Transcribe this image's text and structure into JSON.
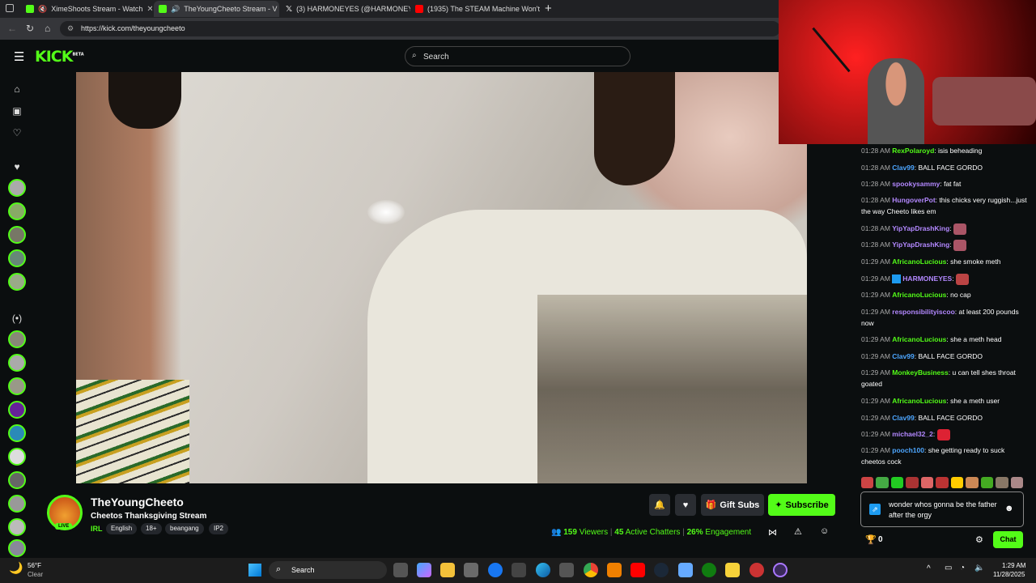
{
  "browser": {
    "tabs": [
      {
        "label": "XimeShoots Stream - Watch",
        "icon": "kick-icon",
        "color": "#53fc18"
      },
      {
        "label": "TheYoungCheeto Stream - V",
        "icon": "kick-icon",
        "color": "#53fc18"
      },
      {
        "label": "(3) HARMONEYES (@HARMONEY",
        "icon": "x-icon",
        "color": "#ffffff"
      },
      {
        "label": "(1935) The STEAM Machine Won't",
        "icon": "youtube-icon",
        "color": "#ff0000"
      }
    ],
    "url": "https://kick.com/theyoungcheeto"
  },
  "header": {
    "logo": "KICK",
    "logo_sup": "BETA",
    "search_placeholder": "Search"
  },
  "channel": {
    "name": "TheYoungCheeto",
    "title": "Cheetos Thanksgiving Stream",
    "live": "LIVE",
    "category": "IRL",
    "tags": [
      "English",
      "18+",
      "beangang",
      "IP2"
    ],
    "gift_subs": "Gift Subs",
    "subscribe": "Subscribe",
    "viewers": "159",
    "viewers_label": "Viewers",
    "chatters": "45",
    "chatters_label": "Active Chatters",
    "engagement": "26%",
    "engagement_label": "Engagement"
  },
  "chat": {
    "messages": [
      {
        "time": "01:28 AM",
        "user": "RexPolaroyd",
        "color": "#53fc18",
        "text": "isis beheading"
      },
      {
        "time": "01:28 AM",
        "user": "Clav99",
        "color": "#4da6ff",
        "text": "BALL FACE GORDO"
      },
      {
        "time": "01:28 AM",
        "user": "spookysammy",
        "color": "#b388ff",
        "text": "fat fat"
      },
      {
        "time": "01:28 AM",
        "user": "HungoverPot",
        "color": "#b388ff",
        "text": "this chicks very ruggish...just the way Cheeto likes em"
      },
      {
        "time": "01:28 AM",
        "user": "YipYapDrashKing",
        "color": "#b388ff",
        "text": ""
      },
      {
        "time": "01:28 AM",
        "user": "YipYapDrashKing",
        "color": "#b388ff",
        "text": ""
      },
      {
        "time": "01:29 AM",
        "user": "AfricanoLucious",
        "color": "#53fc18",
        "text": "she smoke meth"
      },
      {
        "time": "01:29 AM",
        "user": "HARMONEYES",
        "color": "#b388ff",
        "text": ""
      },
      {
        "time": "01:29 AM",
        "user": "AfricanoLucious",
        "color": "#53fc18",
        "text": "no cap"
      },
      {
        "time": "01:29 AM",
        "user": "responsibilityiscoo",
        "color": "#b388ff",
        "text": "at least 200 pounds now"
      },
      {
        "time": "01:29 AM",
        "user": "AfricanoLucious",
        "color": "#53fc18",
        "text": "she a meth head"
      },
      {
        "time": "01:29 AM",
        "user": "Clav99",
        "color": "#4da6ff",
        "text": "BALL FACE GORDO"
      },
      {
        "time": "01:29 AM",
        "user": "MonkeyBusiness",
        "color": "#53fc18",
        "text": "u can tell shes throat goated"
      },
      {
        "time": "01:29 AM",
        "user": "AfricanoLucious",
        "color": "#53fc18",
        "text": "she a meth user"
      },
      {
        "time": "01:29 AM",
        "user": "Clav99",
        "color": "#4da6ff",
        "text": "BALL FACE GORDO"
      },
      {
        "time": "01:29 AM",
        "user": "michael32_2",
        "color": "#b388ff",
        "text": ""
      },
      {
        "time": "01:29 AM",
        "user": "pooch100",
        "color": "#4da6ff",
        "text": "she getting ready to suck cheetos cock"
      }
    ],
    "input_text": "wonder whos gonna be the father after the orgy",
    "count": "0",
    "send_label": "Chat"
  },
  "taskbar": {
    "weather_temp": "56°F",
    "weather_desc": "Clear",
    "search": "Search",
    "time": "1:29 AM",
    "date": "11/28/2025"
  }
}
